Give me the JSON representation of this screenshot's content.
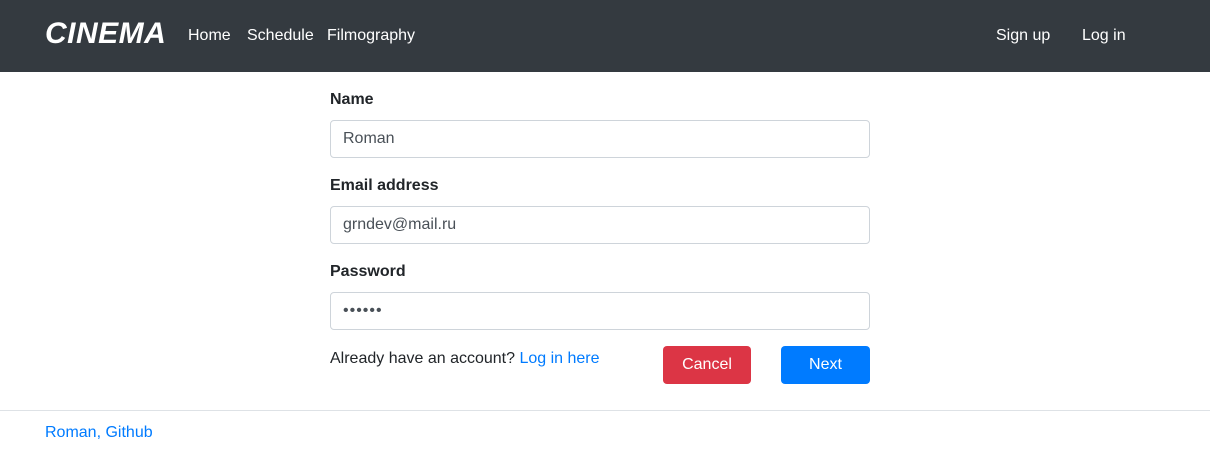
{
  "navbar": {
    "brand": "CINEMA",
    "links": [
      {
        "label": "Home"
      },
      {
        "label": "Schedule"
      },
      {
        "label": "Filmography"
      }
    ],
    "right_links": [
      {
        "label": "Sign up"
      },
      {
        "label": "Log in"
      }
    ]
  },
  "form": {
    "name": {
      "label": "Name",
      "value": "Roman"
    },
    "email": {
      "label": "Email address",
      "value": "grndev@mail.ru"
    },
    "password": {
      "label": "Password",
      "value": "••••••"
    },
    "account_prompt": "Already have an account?",
    "login_link": "Log in here",
    "cancel_label": "Cancel",
    "next_label": "Next"
  },
  "footer": {
    "link": "Roman, Github"
  },
  "colors": {
    "navbar_bg": "#343a40",
    "primary": "#007bff",
    "danger": "#dc3545"
  }
}
